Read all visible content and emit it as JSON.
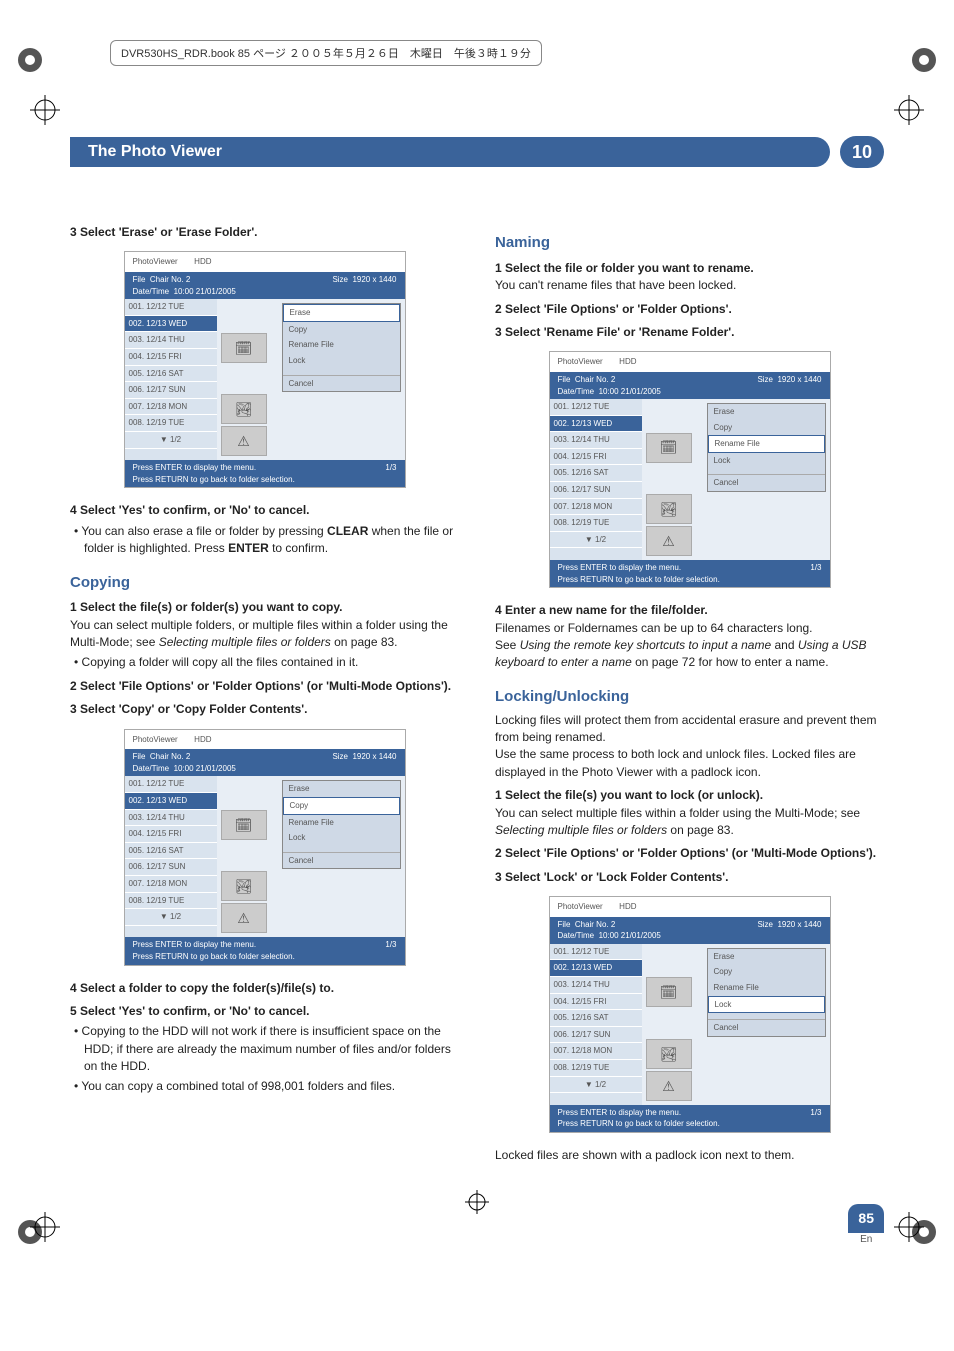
{
  "book_info": "DVR530HS_RDR.book  85 ページ  ２００５年５月２６日　木曜日　午後３時１９分",
  "title": "The Photo Viewer",
  "chapter": "10",
  "page_number": "85",
  "page_lang": "En",
  "left": {
    "s3": "3    Select 'Erase' or 'Erase Folder'.",
    "s4": "4    Select 'Yes' to confirm, or 'No' to cancel.",
    "s4b_pre": "You can also erase a file or folder by pressing ",
    "s4b_key1": "CLEAR",
    "s4b_mid": " when the file or folder is highlighted. Press ",
    "s4b_key2": "ENTER",
    "s4b_post": " to confirm.",
    "copying_hd": "Copying",
    "c1": "1    Select the file(s) or folder(s) you want to copy.",
    "c1t_pre": "You can select multiple folders, or multiple files within a folder using the Multi-Mode; see ",
    "c1t_it": "Selecting multiple files or folders",
    "c1t_post": " on page 83.",
    "c1b": "Copying a folder will copy all the files contained in it.",
    "c2": "2    Select 'File Options' or 'Folder Options' (or 'Multi-Mode Options').",
    "c3": "3    Select 'Copy' or 'Copy Folder Contents'.",
    "c4": "4    Select a folder to copy the folder(s)/file(s) to.",
    "c5": "5    Select 'Yes' to confirm, or 'No' to cancel.",
    "c5b1": "Copying to the HDD will not work if there is insufficient space on the HDD; if there are already the maximum number of files and/or folders on the HDD.",
    "c5b2": "You can copy a combined total of 998,001 folders and files."
  },
  "right": {
    "naming_hd": "Naming",
    "n1": "1    Select the file or folder you want to rename.",
    "n1t": "You can't rename files that have been locked.",
    "n2": "2    Select 'File Options' or 'Folder Options'.",
    "n3": "3    Select 'Rename File' or 'Rename Folder'.",
    "n4": "4    Enter a new name for the file/folder.",
    "n4t": "Filenames or Foldernames can be up to 64 characters long.",
    "n4p_pre": "See ",
    "n4p_it1": "Using the remote key shortcuts to input a name",
    "n4p_mid": " and ",
    "n4p_it2": "Using a USB keyboard to enter a name",
    "n4p_post": " on page 72 for how to enter a name.",
    "lock_hd": "Locking/Unlocking",
    "lt1": "Locking files will protect them from accidental erasure and prevent them from being renamed.",
    "lt2": "Use the same process to both lock and unlock files. Locked files are displayed in the Photo Viewer with a padlock icon.",
    "l1": "1    Select the file(s) you want to lock (or unlock).",
    "l1t_pre": "You can select multiple files within a folder using the Multi-Mode; see ",
    "l1t_it": "Selecting multiple files or folders",
    "l1t_post": " on page 83.",
    "l2": "2    Select 'File Options' or 'Folder Options' (or 'Multi-Mode Options').",
    "l3": "3    Select 'Lock' or 'Lock Folder Contents'.",
    "lfoot": "Locked files are shown with a padlock icon next to them."
  },
  "ui": {
    "pv": "PhotoViewer",
    "hdd": "HDD",
    "file": "File",
    "chair": "Chair No. 2",
    "dt": "Date/Time",
    "dtv": "10:00 21/01/2005",
    "size": "Size",
    "sizev": "1920 x 1440",
    "rows": [
      "001. 12/12 TUE",
      "002. 12/13 WED",
      "003. 12/14 THU",
      "004. 12/15 FRI",
      "005. 12/16 SAT",
      "006. 12/17 SUN",
      "007. 12/18 MON",
      "008. 12/19 TUE"
    ],
    "page": "1/2",
    "foot1": "Press ENTER to display the menu.",
    "foot2": "Press RETURN to go back to folder selection.",
    "footr": "1/3",
    "m_erase": "Erase",
    "m_copy": "Copy",
    "m_rename": "Rename File",
    "m_lock": "Lock",
    "m_cancel": "Cancel"
  }
}
